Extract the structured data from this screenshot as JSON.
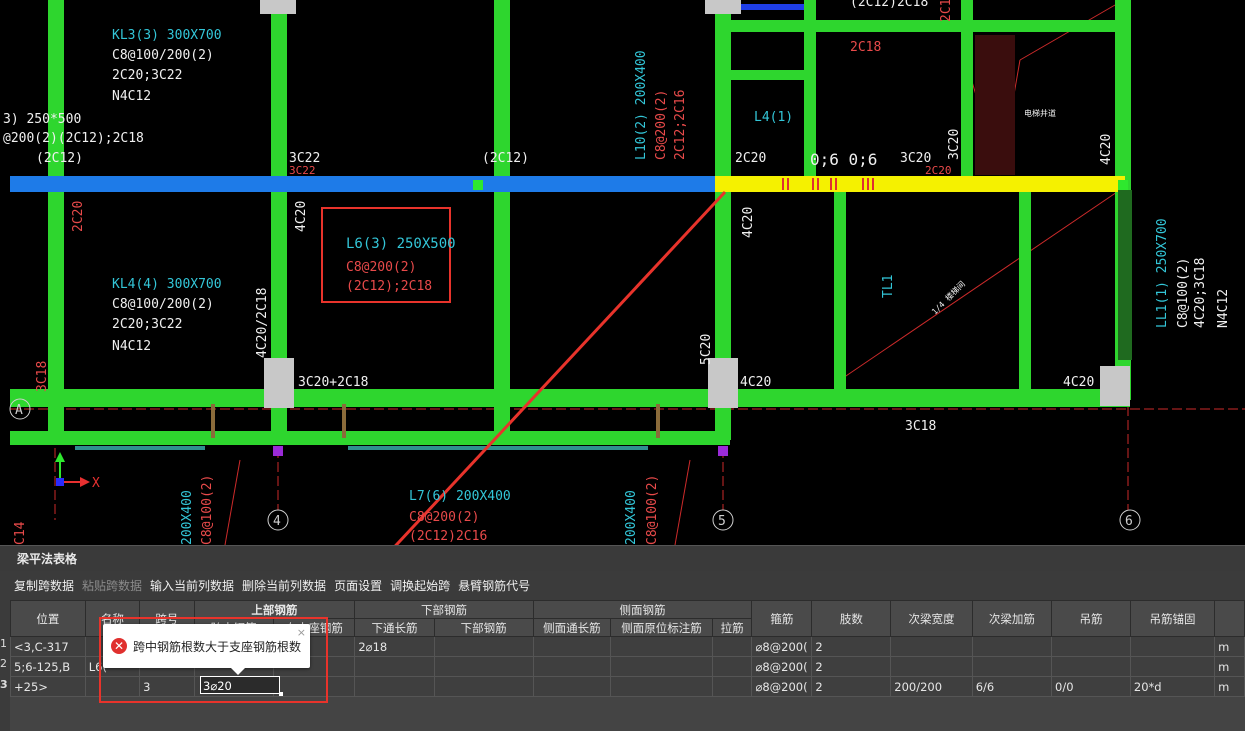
{
  "drawing": {
    "labels": {
      "kl3_name": "KL3(3) 300X700",
      "kl3_stir": "C8@100/200(2)",
      "kl3_top": "2C20;3C22",
      "kl3_side": "N4C12",
      "left_cut_1": "3) 250*500",
      "left_cut_2": "@200(2)(2C12);2C18",
      "left_cut_3": "(2C12)",
      "ann_3c22": "3C22",
      "ann_3c22b": "3C22",
      "ann_2c12": "(2C12)",
      "ann_2c20_left": "2C20",
      "ann_4c20_col": "4C20",
      "l6_name": "L6(3) 250X500",
      "l6_stir": "C8@200(2)",
      "l6_bars": "(2C12);2C18",
      "kl4_name": "KL4(4) 300X700",
      "kl4_stir": "C8@100/200(2)",
      "kl4_top": "2C20;3C22",
      "kl4_side": "N4C12",
      "ann_4c20_2c18": "4C20/2C18",
      "ann_3c20_2c18": "3C20+2C18",
      "ann_3c18_left": "3C18",
      "ann_2c16": "2C16",
      "ann_2c12_2c18_top": "(2C12)2C18",
      "ann_2c18": "2C18",
      "l4_name": "L4(1)",
      "l10_name": "L10(2) 200X400",
      "l10_stir": "C8@200(2)",
      "l10_bars": "2C12;2C16",
      "ann_2c20": "2C20",
      "ann_06": "0;6 0;6",
      "ann_3c20": "3C20",
      "ann_2c20_b": "2C20",
      "ann_3c20_vert": "3C20",
      "ann_4c20_right": "4C20",
      "ann_4c20_mid": "4C20",
      "ann_5c20": "5C20",
      "ann_4c20_low": "4C20",
      "ann_4c20_low2": "4C20",
      "ann_3c18": "3C18",
      "tl1": "TL1",
      "ll1_name": "LL1(1) 250X700",
      "ll1_stir": "C8@100(2)",
      "ll1_top": "4C20;3C18",
      "ll1_side": "N4C12",
      "l7_name": "L7(6) 200X400",
      "l7_stir": "C8@200(2)",
      "l7_bars": "(2C12)2C16",
      "axis_4": "4",
      "axis_5": "5",
      "axis_6": "6",
      "axis_a": "A",
      "x_axis": "X",
      "small_note_1": "电梯井道",
      "small_note_2": "1/4 楼梯间",
      "left_vert_1": "200X400",
      "left_vert_2": "C8@100(2)",
      "left_vert_3": "C14",
      "mid_vert_1": "200X400",
      "mid_vert_2": "C8@100(2)"
    }
  },
  "panel": {
    "title": "梁平法表格",
    "toolbar": [
      "复制跨数据",
      "粘贴跨数据",
      "输入当前列数据",
      "删除当前列数据",
      "页面设置",
      "调换起始跨",
      "悬臂钢筋代号"
    ],
    "toolbar_disabled_index": 1,
    "headers": {
      "position": "位置",
      "name": "名称",
      "span": "跨号",
      "top_group": "上部钢筋",
      "top_mid": "跨中钢筋",
      "right_support": "右支座钢筋",
      "bottom_group": "下部钢筋",
      "bottom_through": "下通长筋",
      "bottom_bar": "下部钢筋",
      "side_group": "侧面钢筋",
      "side_through": "侧面通长筋",
      "side_orig": "侧面原位标注筋",
      "tie": "拉筋",
      "stirrup": "箍筋",
      "legs": "肢数",
      "sub_width": "次梁宽度",
      "sub_add": "次梁加筋",
      "hanger": "吊筋",
      "hanger_anchor": "吊筋锚固"
    },
    "rows": [
      {
        "num": "1",
        "position": "<3,C-317",
        "name": "",
        "span": "",
        "top_mid": "",
        "right_support": "",
        "bottom_through": "2⌀18",
        "stirrup": "⌀8@200(",
        "legs": "2",
        "sub_width": "",
        "sub_add": "",
        "hanger": "",
        "hanger_anchor": "",
        "extra": "m"
      },
      {
        "num": "2",
        "position": "5;6-125,B",
        "name": "L6(",
        "span": "",
        "top_mid": "",
        "right_support": "",
        "bottom_through": "",
        "stirrup": "⌀8@200(",
        "legs": "2",
        "sub_width": "",
        "sub_add": "",
        "hanger": "",
        "hanger_anchor": "",
        "extra": "m"
      },
      {
        "num": "3",
        "position": "+25>",
        "name": "",
        "span": "3",
        "top_mid": "3⌀20",
        "right_support": "",
        "bottom_through": "",
        "stirrup": "⌀8@200(",
        "legs": "2",
        "sub_width": "200/200",
        "sub_add": "6/6",
        "hanger": "0/0",
        "hanger_anchor": "20*d",
        "extra": "m"
      }
    ],
    "error_tooltip": "跨中钢筋根数大于支座钢筋根数",
    "error_close": "×"
  },
  "colors": {
    "beam_green": "#2ed62e",
    "beam_blue": "#1e7be8",
    "beam_yellow": "#f5f100",
    "text_cyan": "#33c6d8",
    "text_red": "#e84a4a",
    "callout_red": "#e8332b"
  }
}
